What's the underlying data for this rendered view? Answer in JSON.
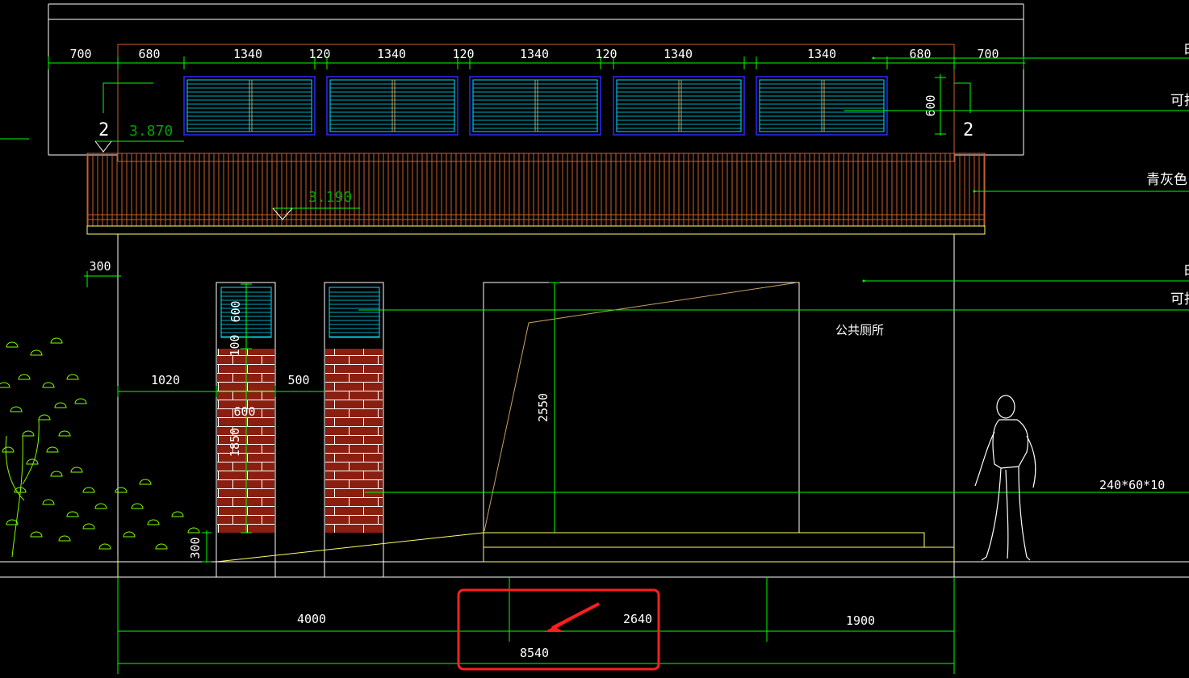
{
  "drawing": {
    "top_dims": [
      "700",
      "680",
      "1340",
      "120",
      "1340",
      "120",
      "1340",
      "120",
      "1340",
      "1340",
      "680",
      "700"
    ],
    "window_height_dim": "600",
    "section_mark": "2",
    "level_top": "3.870",
    "level_mid": "3.190",
    "left_dim_300": "300",
    "dim_1020": "1020",
    "dim_500": "500",
    "dim_600_upper": "600",
    "dim_100": "100",
    "dim_600_lower": "600",
    "dim_1850": "1850",
    "dim_300_bottom": "300",
    "dim_2550": "2550",
    "toilet_label": "公共厕所",
    "bottom_dims": {
      "d1": "4000",
      "d2": "2640",
      "d3": "1900",
      "total": "8540"
    },
    "notes": {
      "n1": "白",
      "n2": "可挡",
      "n3": "青灰色",
      "n4": "白",
      "n5": "可挡",
      "n6": "240*60*10"
    }
  },
  "colors": {
    "green": "#00ff00",
    "orange": "#c8602a",
    "white": "#ffffff",
    "cyan": "#00e5ff",
    "blue": "#2a2aff",
    "yellow": "#ffff66",
    "brick": "#8a1e10",
    "highlight": "#ff1e1e"
  }
}
